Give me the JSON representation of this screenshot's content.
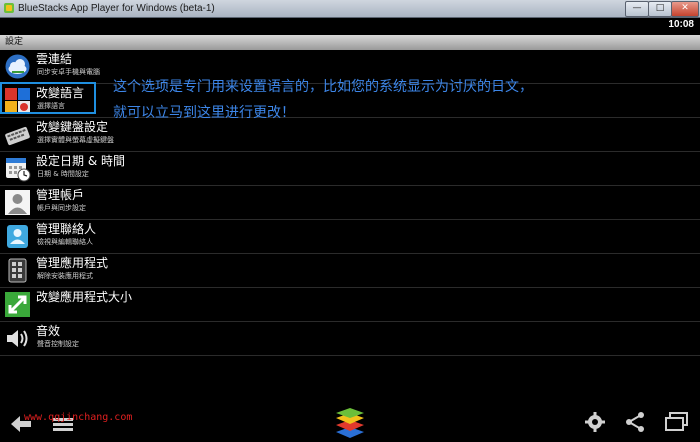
{
  "window": {
    "title": "BlueStacks App Player for Windows (beta-1)",
    "buttons": {
      "minimize": "—",
      "maximize": "□",
      "close": "✕"
    }
  },
  "status": {
    "time": "10:08"
  },
  "header": {
    "title": "設定"
  },
  "settings": [
    {
      "label": "雲連結",
      "sub": "同步安卓手機與電腦",
      "icon": "cloud-connect-icon"
    },
    {
      "label": "改變語言",
      "sub": "選擇語言",
      "icon": "language-icon"
    },
    {
      "label": "改變鍵盤設定",
      "sub": "選擇實體與螢幕虛擬鍵盤",
      "icon": "keyboard-icon"
    },
    {
      "label": "設定日期 & 時間",
      "sub": "日期 & 時間設定",
      "icon": "calendar-clock-icon"
    },
    {
      "label": "管理帳戶",
      "sub": "帳戶與同步設定",
      "icon": "accounts-icon"
    },
    {
      "label": "管理聯絡人",
      "sub": "檢視與編輯聯絡人",
      "icon": "contacts-icon"
    },
    {
      "label": "管理應用程式",
      "sub": "解除安裝應用程式",
      "icon": "apps-manage-icon"
    },
    {
      "label": "改變應用程式大小",
      "sub": "",
      "icon": "resize-app-icon"
    },
    {
      "label": "音效",
      "sub": "聲音控制設定",
      "icon": "speaker-icon"
    }
  ],
  "annotation": {
    "line1": "这个选项是专门用来设置语言的，比如您的系统显示为讨厌的日文，",
    "line2": "就可以立马到这里进行更改！"
  },
  "watermark": "www.qqjinchang.com",
  "colors": {
    "annotation": "#3d86e8",
    "highlight": "#1f8fe0",
    "watermark": "#e02020"
  }
}
